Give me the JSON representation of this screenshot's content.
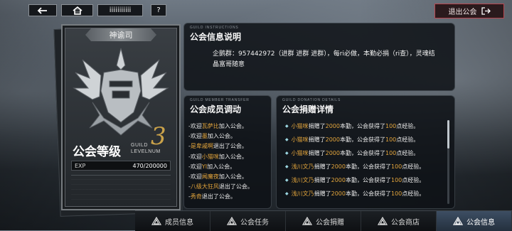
{
  "topbar": {
    "back_icon": "arrow-left-icon",
    "home_icon": "home-icon",
    "name_field": "iiiiiiiiiii",
    "help_label": "?",
    "exit_label": "退出公会",
    "exit_icon": "logout-icon"
  },
  "guild_card": {
    "banner": "神谕司",
    "emblem_icon": "winged-helmet-emblem-icon",
    "level_label": "公会等级",
    "level_sub_line1": "GUILD",
    "level_sub_line2": "LEVELNUM",
    "level": "3",
    "exp_label": "EXP",
    "exp_value": "470/200000",
    "exp_fraction": 0.00235
  },
  "info_panel": {
    "tag": "GUILD INSTRUCTIONS",
    "title": "公会信息说明",
    "body": "企鹅群：957442972（进群 进群 进群），每ri必做，本勤必捐（ri查），灵魂结晶富哥随意"
  },
  "member_panel": {
    "tag": "GUILD MEMBER TRANSFER",
    "title": "公会成员调动",
    "rows": [
      {
        "prefix": "-欢迎",
        "name": "瓦萨比",
        "suffix": "加入公会。"
      },
      {
        "prefix": "-欢迎",
        "name": "墨",
        "suffix": "加入公会。"
      },
      {
        "prefix": "-",
        "name": "是卑戚啊",
        "suffix": "退出了公会。"
      },
      {
        "prefix": "-欢迎",
        "name": "小猫咪",
        "suffix": "加入公会。"
      },
      {
        "prefix": "-欢迎",
        "name": "YI",
        "suffix": "加入公会。"
      },
      {
        "prefix": "-欢迎",
        "name": "闻魔夜",
        "suffix": "加入公会。"
      },
      {
        "prefix": "-",
        "name": "八级大狂风",
        "suffix": "退出了公会。"
      },
      {
        "prefix": "-",
        "name": "秀奇",
        "suffix": "退出了公会。"
      }
    ]
  },
  "donate_panel": {
    "tag": "GUILD DONATION DETAILS",
    "title": "公会捐赠详情",
    "rows": [
      {
        "name": "小猫咪",
        "text1": "捐赠了",
        "amount": "2000",
        "text2": "本勤，公会获得了",
        "exp": "100",
        "text3": "点经验。"
      },
      {
        "name": "小猫咪",
        "text1": "捐赠了",
        "amount": "2000",
        "text2": "本勤，公会获得了",
        "exp": "100",
        "text3": "点经验。"
      },
      {
        "name": "小猫咪",
        "text1": "捐赠了",
        "amount": "2000",
        "text2": "本勤，公会获得了",
        "exp": "100",
        "text3": "点经验。"
      },
      {
        "name": "浅川文乃",
        "text1": "捐赠了",
        "amount": "2000",
        "text2": "本勤，公会获得了",
        "exp": "100",
        "text3": "点经验。"
      },
      {
        "name": "浅川文乃",
        "text1": "捐赠了",
        "amount": "2000",
        "text2": "本勤，公会获得了",
        "exp": "100",
        "text3": "点经验。"
      },
      {
        "name": "浅川文乃",
        "text1": "捐赠了",
        "amount": "2000",
        "text2": "本勤，公会获得了",
        "exp": "100",
        "text3": "点经验。"
      }
    ]
  },
  "tabs": [
    {
      "label": "成员信息",
      "icon": "guild-crest-icon",
      "active": false
    },
    {
      "label": "公会任务",
      "icon": "guild-crest-icon",
      "active": false
    },
    {
      "label": "公会捐赠",
      "icon": "guild-crest-icon",
      "active": false
    },
    {
      "label": "公会商店",
      "icon": "guild-crest-icon",
      "active": false
    },
    {
      "label": "公会信息",
      "icon": "guild-crest-icon",
      "active": true
    }
  ],
  "colors": {
    "accent_gold": "#e3a53c",
    "exit_border": "#b84750",
    "active_tab": "#3d4e63"
  }
}
